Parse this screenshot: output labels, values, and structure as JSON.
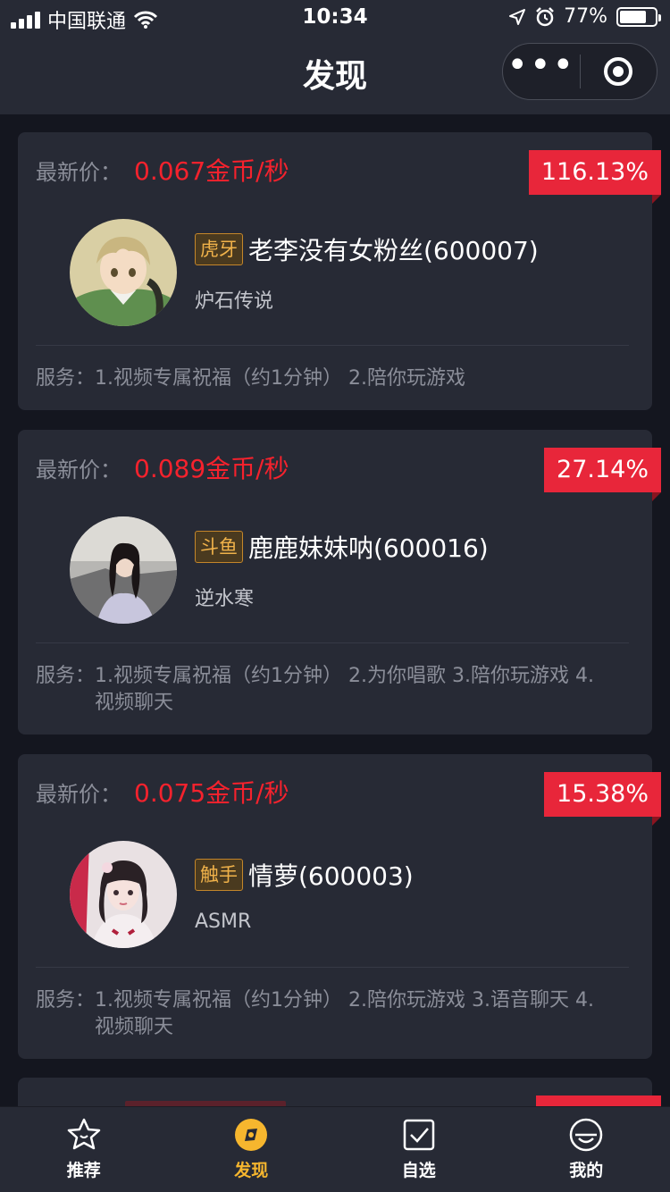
{
  "status_bar": {
    "carrier": "中国联通",
    "time": "10:34",
    "battery": "77%"
  },
  "header": {
    "title": "发现",
    "more_label": "•••"
  },
  "price_label": "最新价：",
  "service_label": "服务：",
  "cards": [
    {
      "price": "0.067金币/秒",
      "change": "116.13%",
      "platform": "虎牙",
      "name": "老李没有女粉丝(600007)",
      "game": "炉石传说",
      "services": "1.视频专属祝福（约1分钟） 2.陪你玩游戏"
    },
    {
      "price": "0.089金币/秒",
      "change": "27.14%",
      "platform": "斗鱼",
      "name": "鹿鹿妹妹呐(600016)",
      "game": "逆水寒",
      "services": "1.视频专属祝福（约1分钟） 2.为你唱歌 3.陪你玩游戏 4.视频聊天"
    },
    {
      "price": "0.075金币/秒",
      "change": "15.38%",
      "platform": "触手",
      "name": "情萝(600003)",
      "game": "ASMR",
      "services": "1.视频专属祝福（约1分钟） 2.陪你玩游戏 3.语音聊天 4.视频聊天"
    }
  ],
  "tabs": [
    {
      "label": "推荐",
      "icon": "star-icon"
    },
    {
      "label": "发现",
      "icon": "discover-icon"
    },
    {
      "label": "自选",
      "icon": "checkbox-icon"
    },
    {
      "label": "我的",
      "icon": "profile-icon"
    }
  ],
  "colors": {
    "price_red": "#f5222d",
    "badge_red": "#e8263a",
    "accent_gold": "#f6b62e",
    "card_bg": "#272a35",
    "page_bg": "#14161f"
  }
}
